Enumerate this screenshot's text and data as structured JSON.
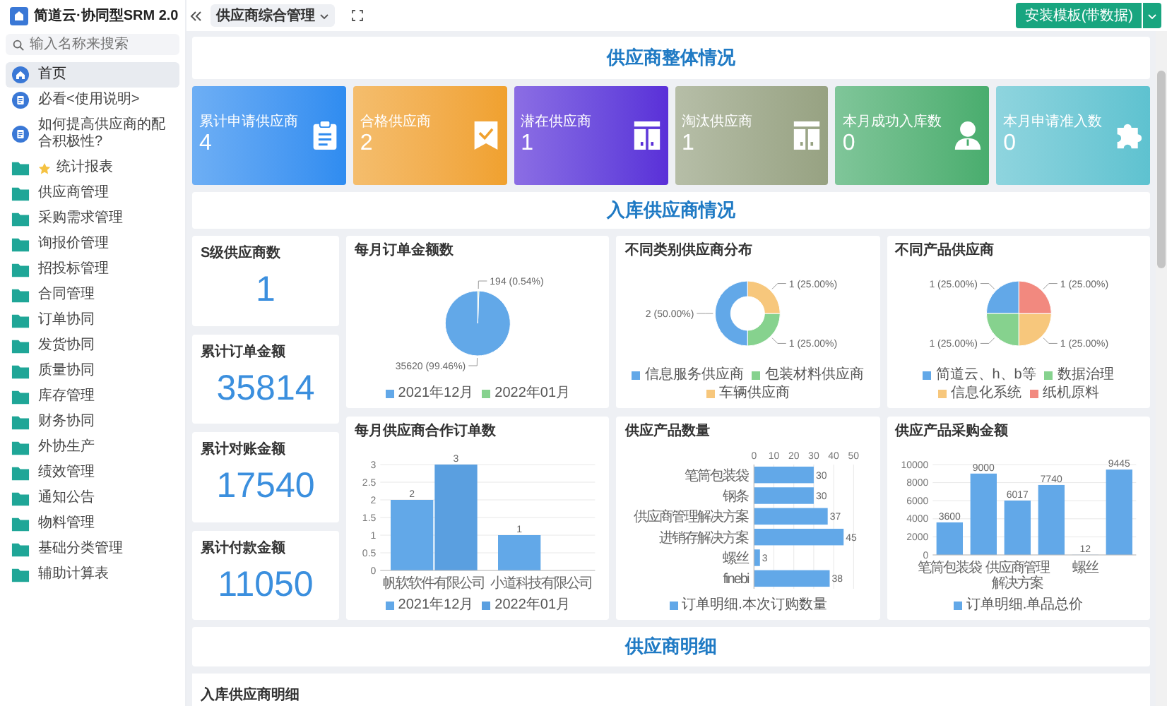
{
  "app": {
    "title": "简道云·协同型SRM 2.0"
  },
  "sidebar": {
    "search": {
      "placeholder": "输入名称来搜索"
    },
    "items": [
      {
        "label": "首页",
        "kind": "home",
        "selected": true,
        "starred": false
      },
      {
        "label": "必看<使用说明>",
        "kind": "doc",
        "selected": false,
        "starred": false
      },
      {
        "label": "如何提高供应商的配合积极性?",
        "kind": "doc",
        "selected": false,
        "starred": false
      },
      {
        "label": "统计报表",
        "kind": "folder",
        "selected": false,
        "starred": true
      },
      {
        "label": "供应商管理",
        "kind": "folder",
        "selected": false,
        "starred": false
      },
      {
        "label": "采购需求管理",
        "kind": "folder",
        "selected": false,
        "starred": false
      },
      {
        "label": "询报价管理",
        "kind": "folder",
        "selected": false,
        "starred": false
      },
      {
        "label": "招投标管理",
        "kind": "folder",
        "selected": false,
        "starred": false
      },
      {
        "label": "合同管理",
        "kind": "folder",
        "selected": false,
        "starred": false
      },
      {
        "label": "订单协同",
        "kind": "folder",
        "selected": false,
        "starred": false
      },
      {
        "label": "发货协同",
        "kind": "folder",
        "selected": false,
        "starred": false
      },
      {
        "label": "质量协同",
        "kind": "folder",
        "selected": false,
        "starred": false
      },
      {
        "label": "库存管理",
        "kind": "folder",
        "selected": false,
        "starred": false
      },
      {
        "label": "财务协同",
        "kind": "folder",
        "selected": false,
        "starred": false
      },
      {
        "label": "外协生产",
        "kind": "folder",
        "selected": false,
        "starred": false
      },
      {
        "label": "绩效管理",
        "kind": "folder",
        "selected": false,
        "starred": false
      },
      {
        "label": "通知公告",
        "kind": "folder",
        "selected": false,
        "starred": false
      },
      {
        "label": "物料管理",
        "kind": "folder",
        "selected": false,
        "starred": false
      },
      {
        "label": "基础分类管理",
        "kind": "folder",
        "selected": false,
        "starred": false
      },
      {
        "label": "辅助计算表",
        "kind": "folder",
        "selected": false,
        "starred": false
      }
    ]
  },
  "topbar": {
    "tab": {
      "label": "供应商综合管理"
    },
    "action": {
      "label": "安装模板(带数据)"
    }
  },
  "overview": {
    "title": "供应商整体情况",
    "stats": [
      {
        "label": "累计申请供应商",
        "value": "4",
        "color": "#2f8cf0"
      },
      {
        "label": "合格供应商",
        "value": "2",
        "color": "#f0a12e"
      },
      {
        "label": "潜在供应商",
        "value": "1",
        "color": "#5a2fd8"
      },
      {
        "label": "淘汰供应商",
        "value": "1",
        "color": "#97a282"
      },
      {
        "label": "本月成功入库数",
        "value": "0",
        "color": "#49ad6e"
      },
      {
        "label": "本月申请准入数",
        "value": "0",
        "color": "#5ec2d0"
      }
    ]
  },
  "inbound": {
    "title": "入库供应商情况",
    "kpis": [
      {
        "label": "S级供应商数",
        "value": "1"
      },
      {
        "label": "累计订单金额",
        "value": "35814"
      },
      {
        "label": "累计对账金额",
        "value": "17540"
      },
      {
        "label": "累计付款金额",
        "value": "11050"
      }
    ],
    "charts": [
      {
        "title": "每月订单金额数",
        "chart_data": {
          "type": "pie",
          "categories": [
            "2021年12月",
            "2022年01月"
          ],
          "values": [
            35620,
            194
          ],
          "colors": [
            "#62a8e8",
            "#86d28e"
          ],
          "value_labels": [
            "35620 (99.46%)",
            "194 (0.54%)"
          ]
        }
      },
      {
        "title": "不同类别供应商分布",
        "chart_data": {
          "type": "donut",
          "categories": [
            "信息服务供应商",
            "包装材料供应商",
            "车辆供应商"
          ],
          "values": [
            2,
            1,
            1
          ],
          "colors": [
            "#62a8e8",
            "#86d28e",
            "#f7c77c"
          ],
          "value_labels": [
            "2 (50.00%)",
            "1 (25.00%)",
            "1 (25.00%)"
          ]
        }
      },
      {
        "title": "不同产品供应商",
        "chart_data": {
          "type": "pie",
          "categories": [
            "简道云、h、b等",
            "数据治理",
            "信息化系统",
            "纸机原料"
          ],
          "values": [
            1,
            1,
            1,
            1
          ],
          "colors": [
            "#62a8e8",
            "#86d28e",
            "#f7c77c",
            "#f2897f"
          ],
          "value_labels": [
            "1 (25.00%)",
            "1 (25.00%)",
            "1 (25.00%)",
            "1 (25.00%)"
          ]
        }
      },
      {
        "title": "每月供应商合作订单数",
        "chart_data": {
          "type": "bar",
          "categories": [
            "帆软软件有限公司",
            "小道科技有限公司"
          ],
          "series": [
            {
              "name": "2021年12月",
              "color": "#62a8e8",
              "values": [
                2,
                1
              ],
              "value_labels": [
                "2",
                "1"
              ]
            },
            {
              "name": "2022年01月",
              "color": "#5a9fe0",
              "values": [
                3,
                null
              ],
              "value_labels": [
                "3",
                null
              ]
            }
          ],
          "ylim": [
            0,
            3
          ],
          "yticks": [
            {
              "value": 0,
              "label": "0"
            },
            {
              "value": 0.5,
              "label": "0.5"
            },
            {
              "value": 1,
              "label": "1"
            },
            {
              "value": 1.5,
              "label": "1.5"
            },
            {
              "value": 2,
              "label": "2"
            },
            {
              "value": 2.5,
              "label": "2.5"
            },
            {
              "value": 3,
              "label": "3"
            }
          ],
          "grid": true
        }
      },
      {
        "title": "供应产品数量",
        "chart_data": {
          "type": "bar",
          "orientation": "horizontal",
          "categories": [
            "笔筒包装袋",
            "钢条",
            "供应商管理解决方案",
            "进销存解决方案",
            "螺丝",
            "finebi"
          ],
          "series": [
            {
              "name": "订单明细.本次订购数量",
              "color": "#62a8e8",
              "values": [
                30,
                30,
                37,
                45,
                3,
                38
              ]
            }
          ],
          "xlim": [
            0,
            50
          ],
          "xticks": [
            {
              "value": 0,
              "label": "0"
            },
            {
              "value": 10,
              "label": "10"
            },
            {
              "value": 20,
              "label": "20"
            },
            {
              "value": 30,
              "label": "30"
            },
            {
              "value": 40,
              "label": "40"
            },
            {
              "value": 50,
              "label": "50"
            }
          ],
          "grid": true,
          "data_labels": true
        }
      },
      {
        "title": "供应产品采购金额",
        "chart_data": {
          "type": "bar",
          "categories": [
            "笔筒包装袋",
            null,
            "供应商管理解决方案",
            null,
            "螺丝",
            null
          ],
          "series": [
            {
              "name": "订单明细.单品总价",
              "color": "#62a8e8",
              "values": [
                3600,
                9000,
                6017,
                7740,
                12,
                9445
              ]
            }
          ],
          "ylim": [
            0,
            10000
          ],
          "yticks": [
            {
              "value": 0,
              "label": "0"
            },
            {
              "value": 2000,
              "label": "2000"
            },
            {
              "value": 4000,
              "label": "4000"
            },
            {
              "value": 6000,
              "label": "6000"
            },
            {
              "value": 8000,
              "label": "8000"
            },
            {
              "value": 10000,
              "label": "10000"
            }
          ],
          "grid": true,
          "data_labels": true
        }
      }
    ]
  },
  "detail": {
    "title": "供应商明细",
    "card": {
      "title": "入库供应商明细"
    }
  }
}
